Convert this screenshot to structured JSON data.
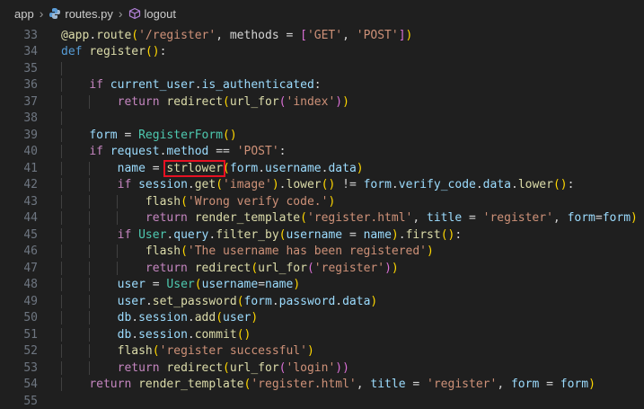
{
  "breadcrumb": {
    "items": [
      "app",
      "routes.py",
      "logout"
    ]
  },
  "lines": [
    {
      "n": "33",
      "tokens": [
        [
          "deco",
          "@app"
        ],
        [
          "op",
          "."
        ],
        [
          "fn",
          "route"
        ],
        [
          "br1",
          "("
        ],
        [
          "str",
          "'/register'"
        ],
        [
          "op",
          ", methods = "
        ],
        [
          "br2",
          "["
        ],
        [
          "str",
          "'GET'"
        ],
        [
          "op",
          ", "
        ],
        [
          "str",
          "'POST'"
        ],
        [
          "br2",
          "]"
        ],
        [
          "br1",
          ")"
        ]
      ],
      "indent": 0
    },
    {
      "n": "34",
      "tokens": [
        [
          "kw",
          "def"
        ],
        [
          "op",
          " "
        ],
        [
          "fn",
          "register"
        ],
        [
          "br1",
          "()"
        ],
        [
          "op",
          ":"
        ]
      ],
      "indent": 0
    },
    {
      "n": "35",
      "tokens": [],
      "indent": 1
    },
    {
      "n": "36",
      "tokens": [
        [
          "ctl",
          "if"
        ],
        [
          "op",
          " "
        ],
        [
          "var",
          "current_user"
        ],
        [
          "op",
          "."
        ],
        [
          "var",
          "is_authenticated"
        ],
        [
          "op",
          ":"
        ]
      ],
      "indent": 1
    },
    {
      "n": "37",
      "tokens": [
        [
          "ctl",
          "return"
        ],
        [
          "op",
          " "
        ],
        [
          "fn",
          "redirect"
        ],
        [
          "br1",
          "("
        ],
        [
          "fn",
          "url_for"
        ],
        [
          "br2",
          "("
        ],
        [
          "str",
          "'index'"
        ],
        [
          "br2",
          ")"
        ],
        [
          "br1",
          ")"
        ]
      ],
      "indent": 2
    },
    {
      "n": "38",
      "tokens": [],
      "indent": 1
    },
    {
      "n": "39",
      "tokens": [
        [
          "var",
          "form"
        ],
        [
          "op",
          " = "
        ],
        [
          "cls",
          "RegisterForm"
        ],
        [
          "br1",
          "()"
        ]
      ],
      "indent": 1
    },
    {
      "n": "40",
      "tokens": [
        [
          "ctl",
          "if"
        ],
        [
          "op",
          " "
        ],
        [
          "var",
          "request"
        ],
        [
          "op",
          "."
        ],
        [
          "var",
          "method"
        ],
        [
          "op",
          " == "
        ],
        [
          "str",
          "'POST'"
        ],
        [
          "op",
          ":"
        ]
      ],
      "indent": 1
    },
    {
      "n": "41",
      "tokens": [
        [
          "var",
          "name"
        ],
        [
          "op",
          " = "
        ],
        [
          "fn",
          "strlower"
        ],
        [
          "br1",
          "("
        ],
        [
          "var",
          "form"
        ],
        [
          "op",
          "."
        ],
        [
          "var",
          "username"
        ],
        [
          "op",
          "."
        ],
        [
          "var",
          "data"
        ],
        [
          "br1",
          ")"
        ]
      ],
      "indent": 2
    },
    {
      "n": "42",
      "tokens": [
        [
          "ctl",
          "if"
        ],
        [
          "op",
          " "
        ],
        [
          "var",
          "session"
        ],
        [
          "op",
          "."
        ],
        [
          "fn",
          "get"
        ],
        [
          "br1",
          "("
        ],
        [
          "str",
          "'image'"
        ],
        [
          "br1",
          ")"
        ],
        [
          "op",
          "."
        ],
        [
          "fn",
          "lower"
        ],
        [
          "br1",
          "()"
        ],
        [
          "op",
          " != "
        ],
        [
          "var",
          "form"
        ],
        [
          "op",
          "."
        ],
        [
          "var",
          "verify_code"
        ],
        [
          "op",
          "."
        ],
        [
          "var",
          "data"
        ],
        [
          "op",
          "."
        ],
        [
          "fn",
          "lower"
        ],
        [
          "br1",
          "()"
        ],
        [
          "op",
          ":"
        ]
      ],
      "indent": 2
    },
    {
      "n": "43",
      "tokens": [
        [
          "fn",
          "flash"
        ],
        [
          "br1",
          "("
        ],
        [
          "str",
          "'Wrong verify code.'"
        ],
        [
          "br1",
          ")"
        ]
      ],
      "indent": 3
    },
    {
      "n": "44",
      "tokens": [
        [
          "ctl",
          "return"
        ],
        [
          "op",
          " "
        ],
        [
          "fn",
          "render_template"
        ],
        [
          "br1",
          "("
        ],
        [
          "str",
          "'register.html'"
        ],
        [
          "op",
          ", "
        ],
        [
          "var",
          "title"
        ],
        [
          "op",
          " = "
        ],
        [
          "str",
          "'register'"
        ],
        [
          "op",
          ", "
        ],
        [
          "var",
          "form"
        ],
        [
          "op",
          "="
        ],
        [
          "var",
          "form"
        ],
        [
          "br1",
          ")"
        ]
      ],
      "indent": 3
    },
    {
      "n": "45",
      "tokens": [
        [
          "ctl",
          "if"
        ],
        [
          "op",
          " "
        ],
        [
          "cls",
          "User"
        ],
        [
          "op",
          "."
        ],
        [
          "var",
          "query"
        ],
        [
          "op",
          "."
        ],
        [
          "fn",
          "filter_by"
        ],
        [
          "br1",
          "("
        ],
        [
          "var",
          "username"
        ],
        [
          "op",
          " = "
        ],
        [
          "var",
          "name"
        ],
        [
          "br1",
          ")"
        ],
        [
          "op",
          "."
        ],
        [
          "fn",
          "first"
        ],
        [
          "br1",
          "()"
        ],
        [
          "op",
          ":"
        ]
      ],
      "indent": 2
    },
    {
      "n": "46",
      "tokens": [
        [
          "fn",
          "flash"
        ],
        [
          "br1",
          "("
        ],
        [
          "str",
          "'The username has been registered'"
        ],
        [
          "br1",
          ")"
        ]
      ],
      "indent": 3
    },
    {
      "n": "47",
      "tokens": [
        [
          "ctl",
          "return"
        ],
        [
          "op",
          " "
        ],
        [
          "fn",
          "redirect"
        ],
        [
          "br1",
          "("
        ],
        [
          "fn",
          "url_for"
        ],
        [
          "br2",
          "("
        ],
        [
          "str",
          "'register'"
        ],
        [
          "br2",
          ")"
        ],
        [
          "br1",
          ")"
        ]
      ],
      "indent": 3
    },
    {
      "n": "48",
      "tokens": [
        [
          "var",
          "user"
        ],
        [
          "op",
          " = "
        ],
        [
          "cls",
          "User"
        ],
        [
          "br1",
          "("
        ],
        [
          "var",
          "username"
        ],
        [
          "op",
          "="
        ],
        [
          "var",
          "name"
        ],
        [
          "br1",
          ")"
        ]
      ],
      "indent": 2
    },
    {
      "n": "49",
      "tokens": [
        [
          "var",
          "user"
        ],
        [
          "op",
          "."
        ],
        [
          "fn",
          "set_password"
        ],
        [
          "br1",
          "("
        ],
        [
          "var",
          "form"
        ],
        [
          "op",
          "."
        ],
        [
          "var",
          "password"
        ],
        [
          "op",
          "."
        ],
        [
          "var",
          "data"
        ],
        [
          "br1",
          ")"
        ]
      ],
      "indent": 2
    },
    {
      "n": "50",
      "tokens": [
        [
          "var",
          "db"
        ],
        [
          "op",
          "."
        ],
        [
          "var",
          "session"
        ],
        [
          "op",
          "."
        ],
        [
          "fn",
          "add"
        ],
        [
          "br1",
          "("
        ],
        [
          "var",
          "user"
        ],
        [
          "br1",
          ")"
        ]
      ],
      "indent": 2
    },
    {
      "n": "51",
      "tokens": [
        [
          "var",
          "db"
        ],
        [
          "op",
          "."
        ],
        [
          "var",
          "session"
        ],
        [
          "op",
          "."
        ],
        [
          "fn",
          "commit"
        ],
        [
          "br1",
          "()"
        ]
      ],
      "indent": 2
    },
    {
      "n": "52",
      "tokens": [
        [
          "fn",
          "flash"
        ],
        [
          "br1",
          "("
        ],
        [
          "str",
          "'register successful'"
        ],
        [
          "br1",
          ")"
        ]
      ],
      "indent": 2
    },
    {
      "n": "53",
      "tokens": [
        [
          "ctl",
          "return"
        ],
        [
          "op",
          " "
        ],
        [
          "fn",
          "redirect"
        ],
        [
          "br1",
          "("
        ],
        [
          "fn",
          "url_for"
        ],
        [
          "br2",
          "("
        ],
        [
          "str",
          "'login'"
        ],
        [
          "br2",
          "))"
        ]
      ],
      "indent": 2
    },
    {
      "n": "54",
      "tokens": [
        [
          "ctl",
          "return"
        ],
        [
          "op",
          " "
        ],
        [
          "fn",
          "render_template"
        ],
        [
          "br1",
          "("
        ],
        [
          "str",
          "'register.html'"
        ],
        [
          "op",
          ", "
        ],
        [
          "var",
          "title"
        ],
        [
          "op",
          " = "
        ],
        [
          "str",
          "'register'"
        ],
        [
          "op",
          ", "
        ],
        [
          "var",
          "form"
        ],
        [
          "op",
          " = "
        ],
        [
          "var",
          "form"
        ],
        [
          "br1",
          ")"
        ]
      ],
      "indent": 1
    },
    {
      "n": "55",
      "tokens": [],
      "indent": 0
    }
  ],
  "highlight": {
    "line": "41",
    "text": "strlower",
    "color": "#e81123"
  }
}
